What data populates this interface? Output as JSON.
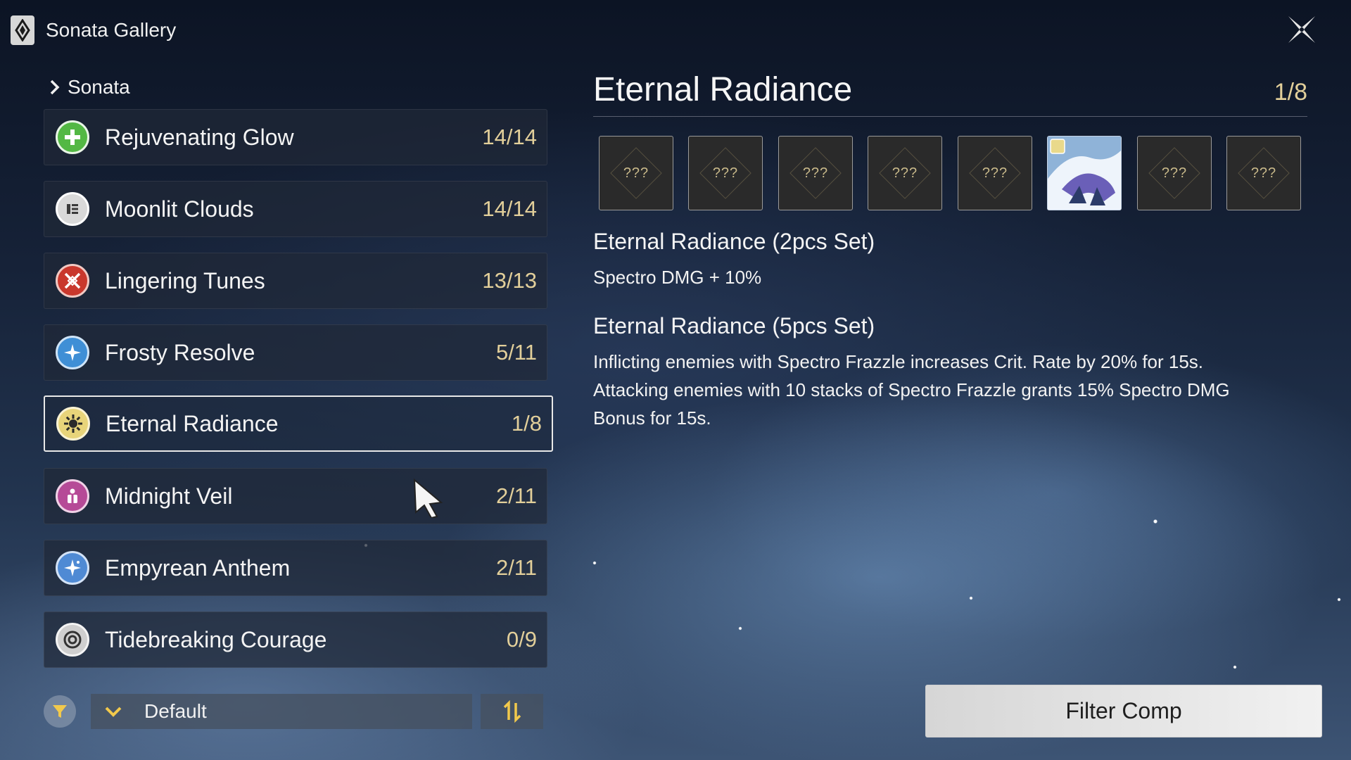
{
  "header": {
    "title": "Sonata Gallery",
    "logo_icon": "sonata-logo-icon",
    "close_icon": "close-icon"
  },
  "breadcrumb": {
    "label": "Sonata",
    "icon": "chevron-right-icon"
  },
  "sets": [
    {
      "name": "Rejuvenating Glow",
      "count": "14/14",
      "icon": "healing-cross-icon",
      "color": "#53b844"
    },
    {
      "name": "Moonlit Clouds",
      "count": "14/14",
      "icon": "moonlit-clouds-icon",
      "color": "#d9d9d9"
    },
    {
      "name": "Lingering Tunes",
      "count": "13/13",
      "icon": "crossed-swords-icon",
      "color": "#d24a3c"
    },
    {
      "name": "Frosty Resolve",
      "count": "5/11",
      "icon": "frost-star-icon",
      "color": "#5fa8e8"
    },
    {
      "name": "Eternal Radiance",
      "count": "1/8",
      "icon": "radiance-sun-icon",
      "color": "#e8d47a",
      "selected": true
    },
    {
      "name": "Midnight Veil",
      "count": "2/11",
      "icon": "midnight-veil-icon",
      "color": "#c65aa8"
    },
    {
      "name": "Empyrean Anthem",
      "count": "2/11",
      "icon": "anthem-star-icon",
      "color": "#6fa6e6"
    },
    {
      "name": "Tidebreaking Courage",
      "count": "0/9",
      "icon": "tide-ring-icon",
      "color": "#cfcfcf"
    }
  ],
  "controls": {
    "sort_label": "Default",
    "filter_icon": "filter-funnel-icon",
    "order_icon": "sort-order-icon",
    "chevron_icon": "chevron-down-icon"
  },
  "detail": {
    "title": "Eternal Radiance",
    "count": "1/8",
    "slots": [
      {
        "label": "???",
        "owned": false
      },
      {
        "label": "???",
        "owned": false
      },
      {
        "label": "???",
        "owned": false
      },
      {
        "label": "???",
        "owned": false
      },
      {
        "label": "???",
        "owned": false
      },
      {
        "label": "",
        "owned": true,
        "icon": "echo-creature-icon"
      },
      {
        "label": "???",
        "owned": false
      },
      {
        "label": "???",
        "owned": false
      }
    ],
    "two_piece_title": "Eternal Radiance (2pcs Set)",
    "two_piece_text": "Spectro DMG + 10%",
    "five_piece_title": "Eternal Radiance (5pcs Set)",
    "five_piece_lines": [
      "Inflicting enemies with Spectro Frazzle increases Crit. Rate by 20% for 15s.",
      "Attacking enemies with 10 stacks of Spectro Frazzle grants 15% Spectro DMG",
      "Bonus for 15s."
    ]
  },
  "filter_comp_label": "Filter Comp"
}
